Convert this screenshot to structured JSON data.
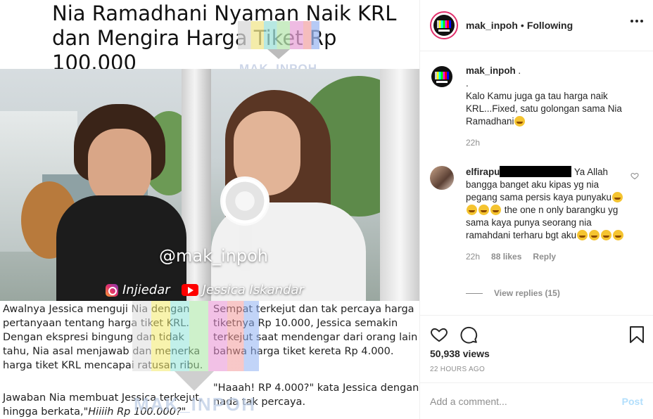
{
  "media": {
    "headline": "Nia Ramadhani Nyaman Naik KRL dan Mengira Harga Tiket Rp 100.000",
    "watermark": "MAK_INPOH",
    "overlay_handle": "@mak_inpoh",
    "credit_ig": "Injiedar",
    "credit_yt": "Jessica Iskandar",
    "text_left": "Awalnya Jessica menguji Nia dengan pertanyaan tentang harga tiket KRL. Dengan ekspresi bingung dan tidak tahu, Nia asal menjawab dan menerka harga tiket KRL mencapai ratusan ribu.",
    "text_left2_a": "Jawaban Nia membuat Jessica terkejut, hingga berkata,\"",
    "text_left2_b": "Hiiiih Rp 100.000?",
    "text_left2_c": "\"",
    "text_right": "Sempat terkejut dan tak percaya harga tiketnya Rp 10.000, Jessica semakin terkejut saat mendengar dari orang lain bahwa harga tiket kereta Rp 4.000.",
    "text_quote": "\"Haaah! RP 4.000?\" kata Jessica dengan nada tak percaya."
  },
  "header": {
    "username": "mak_inpoh",
    "dot": "•",
    "follow_status": "Following"
  },
  "caption": {
    "username": "mak_inpoh",
    "text_1": ".",
    "text_2": ".",
    "text_3": "Kalo Kamu juga ga tau harga naik KRL...Fixed, satu golongan sama Nia Ramadhani",
    "time": "22h"
  },
  "comment": {
    "username": "elfirapu",
    "text_1": "Ya Allah bangga banget aku kipas yg nia pegang sama persis kaya punyaku",
    "text_2": "the one n only barangku yg sama kaya punya seorang nia ramahdani terharu bgt aku",
    "time": "22h",
    "likes": "88 likes",
    "reply": "Reply",
    "view_replies": "View replies (15)"
  },
  "actions": {
    "views": "50,938 views",
    "time_ago": "22 hours ago"
  },
  "add_comment": {
    "placeholder": "Add a comment...",
    "post_label": "Post"
  },
  "colors": {
    "ig_pink": "#e1306c",
    "muted": "#8e8e8e",
    "post_disabled": "#b2dffc"
  }
}
